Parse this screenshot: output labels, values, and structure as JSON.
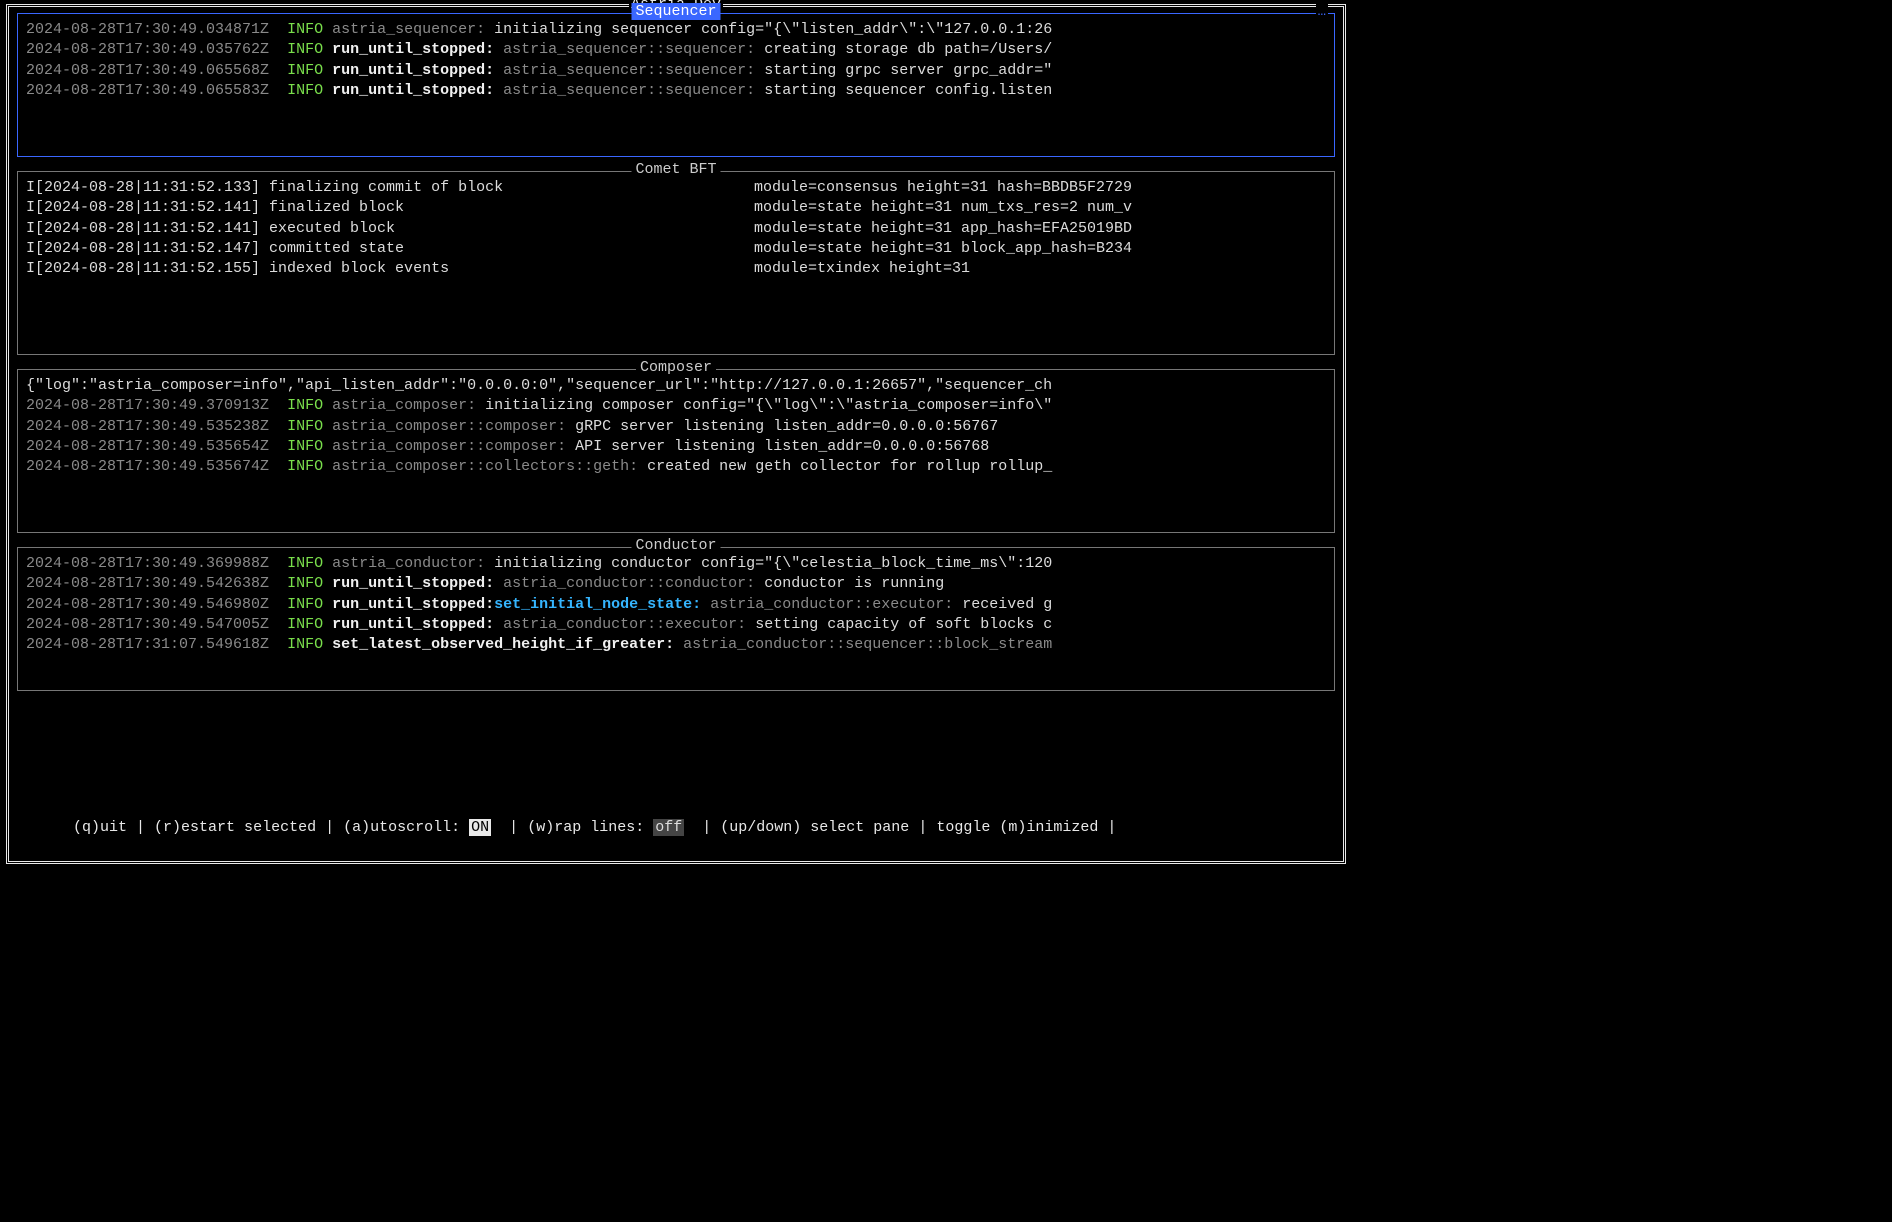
{
  "app": {
    "title": "Astria Dev"
  },
  "panes": {
    "sequencer": {
      "title": "Sequencer",
      "selected": true,
      "lines": [
        {
          "ts": "2024-08-28T17:30:49.034871Z",
          "lvl": "INFO",
          "scope": "astria_sequencer:",
          "scope_bold": false,
          "msg": "initializing sequencer config=\"{\\\"listen_addr\\\":\\\"127.0.0.1:26"
        },
        {
          "ts": "2024-08-28T17:30:49.035762Z",
          "lvl": "INFO",
          "scope": "run_until_stopped:",
          "scope_bold": true,
          "mod": "astria_sequencer::sequencer:",
          "msg": "creating storage db path=/Users/"
        },
        {
          "ts": "2024-08-28T17:30:49.065568Z",
          "lvl": "INFO",
          "scope": "run_until_stopped:",
          "scope_bold": true,
          "mod": "astria_sequencer::sequencer:",
          "msg": "starting grpc server grpc_addr=\""
        },
        {
          "ts": "2024-08-28T17:30:49.065583Z",
          "lvl": "INFO",
          "scope": "run_until_stopped:",
          "scope_bold": true,
          "mod": "astria_sequencer::sequencer:",
          "msg": "starting sequencer config.listen"
        }
      ]
    },
    "comet": {
      "title": "Comet BFT",
      "selected": false,
      "lines": [
        {
          "raw_l": "I[2024-08-28|11:31:52.133] finalizing commit of block",
          "raw_r": "module=consensus height=31 hash=BBDB5F2729"
        },
        {
          "raw_l": "I[2024-08-28|11:31:52.141] finalized block",
          "raw_r": "module=state height=31 num_txs_res=2 num_v"
        },
        {
          "raw_l": "I[2024-08-28|11:31:52.141] executed block",
          "raw_r": "module=state height=31 app_hash=EFA25019BD"
        },
        {
          "raw_l": "I[2024-08-28|11:31:52.147] committed state",
          "raw_r": "module=state height=31 block_app_hash=B234"
        },
        {
          "raw_l": "I[2024-08-28|11:31:52.155] indexed block events",
          "raw_r": "module=txindex height=31"
        }
      ]
    },
    "composer": {
      "title": "Composer",
      "selected": false,
      "lines": [
        {
          "raw": "{\"log\":\"astria_composer=info\",\"api_listen_addr\":\"0.0.0.0:0\",\"sequencer_url\":\"http://127.0.0.1:26657\",\"sequencer_ch"
        },
        {
          "ts": "2024-08-28T17:30:49.370913Z",
          "lvl": "INFO",
          "scope": "astria_composer:",
          "scope_bold": false,
          "msg": "initializing composer config=\"{\\\"log\\\":\\\"astria_composer=info\\\""
        },
        {
          "ts": "2024-08-28T17:30:49.535238Z",
          "lvl": "INFO",
          "scope": "astria_composer::composer:",
          "scope_bold": false,
          "msg": "gRPC server listening listen_addr=0.0.0.0:56767"
        },
        {
          "ts": "2024-08-28T17:30:49.535654Z",
          "lvl": "INFO",
          "scope": "astria_composer::composer:",
          "scope_bold": false,
          "msg": "API server listening listen_addr=0.0.0.0:56768"
        },
        {
          "ts": "2024-08-28T17:30:49.535674Z",
          "lvl": "INFO",
          "scope": "astria_composer::collectors::geth:",
          "scope_bold": false,
          "msg": "created new geth collector for rollup rollup_"
        }
      ]
    },
    "conductor": {
      "title": "Conductor",
      "selected": false,
      "lines": [
        {
          "ts": "2024-08-28T17:30:49.369988Z",
          "lvl": "INFO",
          "scope": "astria_conductor:",
          "scope_bold": false,
          "msg": "initializing conductor config=\"{\\\"celestia_block_time_ms\\\":120"
        },
        {
          "ts": "2024-08-28T17:30:49.542638Z",
          "lvl": "INFO",
          "scope": "run_until_stopped:",
          "scope_bold": true,
          "mod": "astria_conductor::conductor:",
          "msg": "conductor is running"
        },
        {
          "ts": "2024-08-28T17:30:49.546980Z",
          "lvl": "INFO",
          "scope": "run_until_stopped:",
          "scope_bold": true,
          "kw": "set_initial_node_state:",
          "mod": "astria_conductor::executor:",
          "msg": "received g"
        },
        {
          "ts": "2024-08-28T17:30:49.547005Z",
          "lvl": "INFO",
          "scope": "run_until_stopped:",
          "scope_bold": true,
          "mod": "astria_conductor::executor:",
          "msg": "setting capacity of soft blocks c"
        },
        {
          "ts": "2024-08-28T17:31:07.549618Z",
          "lvl": "INFO",
          "scope": "set_latest_observed_height_if_greater:",
          "scope_bold": true,
          "mod": "astria_conductor::sequencer::block_stream",
          "msg": ""
        }
      ]
    }
  },
  "footer": {
    "quit": "(q)uit",
    "restart": "(r)estart selected",
    "autoscroll_label": "(a)utoscroll:",
    "autoscroll_value": "ON",
    "wrap_label": "(w)rap lines:",
    "wrap_value": "off",
    "select": "(up/down) select pane",
    "toggle": "toggle (m)inimized",
    "sep": " | "
  }
}
